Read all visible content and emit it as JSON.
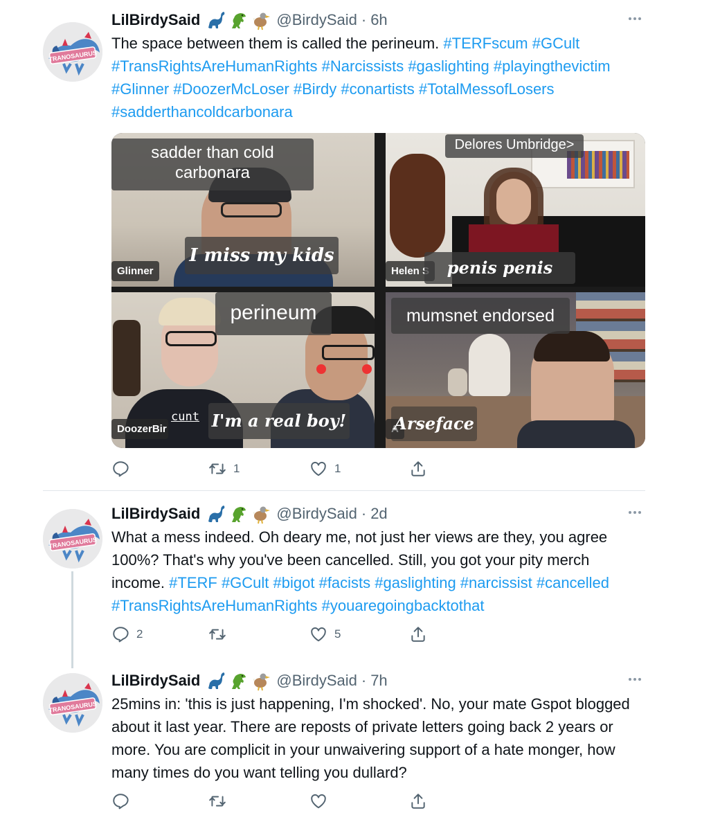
{
  "tweets": [
    {
      "display_name": "LilBirdySaid",
      "handle": "@BirdySaid",
      "time": "6h",
      "emoji_icons": [
        "sauropod-emoji",
        "t-rex-emoji",
        "dodo-emoji"
      ],
      "text_parts": [
        {
          "t": "The space between them is called the perineum. ",
          "tag": false
        },
        {
          "t": "#TERFscum #GCult #TransRightsAreHumanRights #Narcissists #gaslighting #playingthevictim #Glinner #DoozerMcLoser #Birdy #conartists #TotalMessofLosers #sadderthancoldcarbonara",
          "tag": true
        }
      ],
      "replies": "",
      "retweets": "1",
      "likes": "1"
    },
    {
      "display_name": "LilBirdySaid",
      "handle": "@BirdySaid",
      "time": "2d",
      "emoji_icons": [
        "sauropod-emoji",
        "t-rex-emoji",
        "dodo-emoji"
      ],
      "text_parts": [
        {
          "t": "What a mess indeed. Oh deary me, not just her views are they, you agree 100%? That's why you've been cancelled. Still, you got your pity merch income. ",
          "tag": false
        },
        {
          "t": "#TERF #GCult #bigot #facists #gaslighting #narcissist #cancelled #TransRightsAreHumanRights #youaregoingbacktothat",
          "tag": true
        }
      ],
      "replies": "2",
      "retweets": "",
      "likes": "5"
    },
    {
      "display_name": "LilBirdySaid",
      "handle": "@BirdySaid",
      "time": "7h",
      "emoji_icons": [
        "sauropod-emoji",
        "t-rex-emoji",
        "dodo-emoji"
      ],
      "text_parts": [
        {
          "t": "25mins in: 'this is just happening, I'm shocked'. No, your mate Gspot blogged about it last year. There are reposts of private letters going back 2 years or more. You are complicit in your unwaivering support of a hate monger, how many times do you want telling you dullard?",
          "tag": false
        }
      ],
      "replies": "",
      "retweets": "",
      "likes": ""
    }
  ],
  "separator": "·",
  "avatar_text": "TRANOSAURUS",
  "media": {
    "top_left": {
      "caption_top": "sadder than cold carbonara",
      "caption_bottom": "I miss my kids",
      "name_tag": "Glinner"
    },
    "top_right": {
      "caption_top": "Delores Umbridge>",
      "caption_bottom": "penis penis penis",
      "name_tag": "Helen S"
    },
    "bottom_left": {
      "caption_top": "perineum",
      "caption_bottom": "I'm a real boy!",
      "name_tag": "DoozerBir",
      "scribble": "cunt"
    },
    "bottom_right": {
      "caption_top": "mumsnet endorsed",
      "caption_bottom": "Arseface",
      "name_tag": "A"
    }
  },
  "colors": {
    "link": "#1d9bf0",
    "muted": "#536471",
    "text": "#0f1419",
    "divider": "#e1e6ea"
  }
}
